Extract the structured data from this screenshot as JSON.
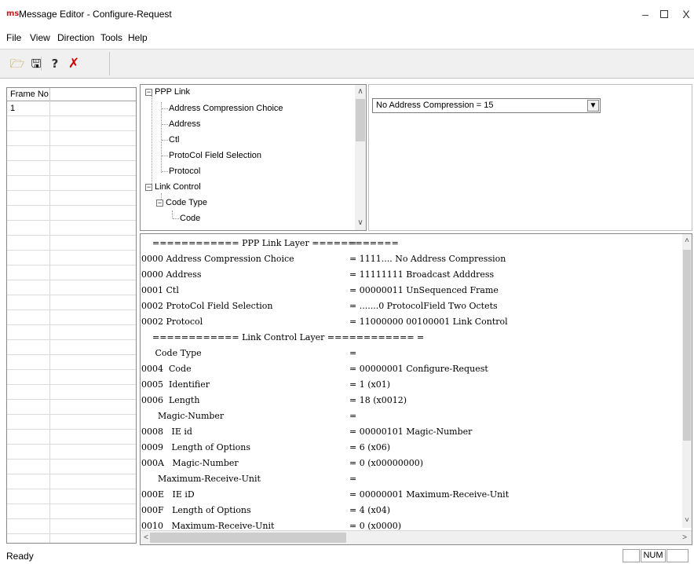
{
  "window": {
    "title": "Message Editor - Configure-Request",
    "app_icon": "app-logo-icon",
    "min_glyph": "–",
    "close_glyph": "X"
  },
  "menu": [
    "File",
    "View",
    "Direction",
    "Tools",
    "Help"
  ],
  "toolbar": {
    "buttons": [
      {
        "name": "open-icon",
        "glyph": "🗁"
      },
      {
        "name": "save-icon",
        "glyph": "🖫"
      },
      {
        "name": "help-icon",
        "glyph": "?"
      },
      {
        "name": "exit-icon",
        "glyph": "✗"
      }
    ]
  },
  "frame_list": {
    "header": "Frame No",
    "rows": [
      "1"
    ]
  },
  "tree": {
    "nodes": [
      {
        "label": "PPP Link",
        "expand": "−"
      },
      {
        "label": "Address Compression Choice"
      },
      {
        "label": "Address"
      },
      {
        "label": "Ctl"
      },
      {
        "label": "ProtoCol Field Selection"
      },
      {
        "label": "Protocol"
      },
      {
        "label": "Link Control",
        "expand": "−"
      },
      {
        "label": "Code Type",
        "expand": "−"
      },
      {
        "label": "Code"
      }
    ]
  },
  "value_panel": {
    "dropdown_value": "No Address Compression = 15"
  },
  "decode": {
    "lines": [
      {
        "left": "    ============ PPP Link Layer ============",
        "right": "="
      },
      {
        "left": "0000 Address Compression Choice",
        "right": "= 1111.... No Address Compression"
      },
      {
        "left": "0000 Address",
        "right": "= 11111111 Broadcast Adddress"
      },
      {
        "left": "0001 Ctl",
        "right": "= 00000011 UnSequenced Frame"
      },
      {
        "left": "0002 ProtoCol Field Selection",
        "right": "= .......0 ProtocolField Two Octets"
      },
      {
        "left": "0002 Protocol",
        "right": "= 11000000 00100001 Link Control"
      },
      {
        "left": "    ============ Link Control Layer ============ =",
        "right": ""
      },
      {
        "left": "     Code Type",
        "right": "="
      },
      {
        "left": "0004  Code",
        "right": "= 00000001 Configure-Request"
      },
      {
        "left": "0005  Identifier",
        "right": "= 1 (x01)"
      },
      {
        "left": "0006  Length",
        "right": "= 18 (x0012)"
      },
      {
        "left": "      Magic-Number",
        "right": "="
      },
      {
        "left": "0008   IE id",
        "right": "= 00000101 Magic-Number"
      },
      {
        "left": "0009   Length of Options",
        "right": "= 6 (x06)"
      },
      {
        "left": "000A   Magic-Number",
        "right": "= 0 (x00000000)"
      },
      {
        "left": "      Maximum-Receive-Unit",
        "right": "="
      },
      {
        "left": "000E   IE iD",
        "right": "= 00000001 Maximum-Receive-Unit"
      },
      {
        "left": "000F   Length of Options",
        "right": "= 4 (x04)"
      },
      {
        "left": "0010   Maximum-Receive-Unit",
        "right": "= 0 (x0000)"
      }
    ]
  },
  "status": {
    "text": "Ready",
    "cells": [
      "",
      "NUM",
      ""
    ]
  }
}
